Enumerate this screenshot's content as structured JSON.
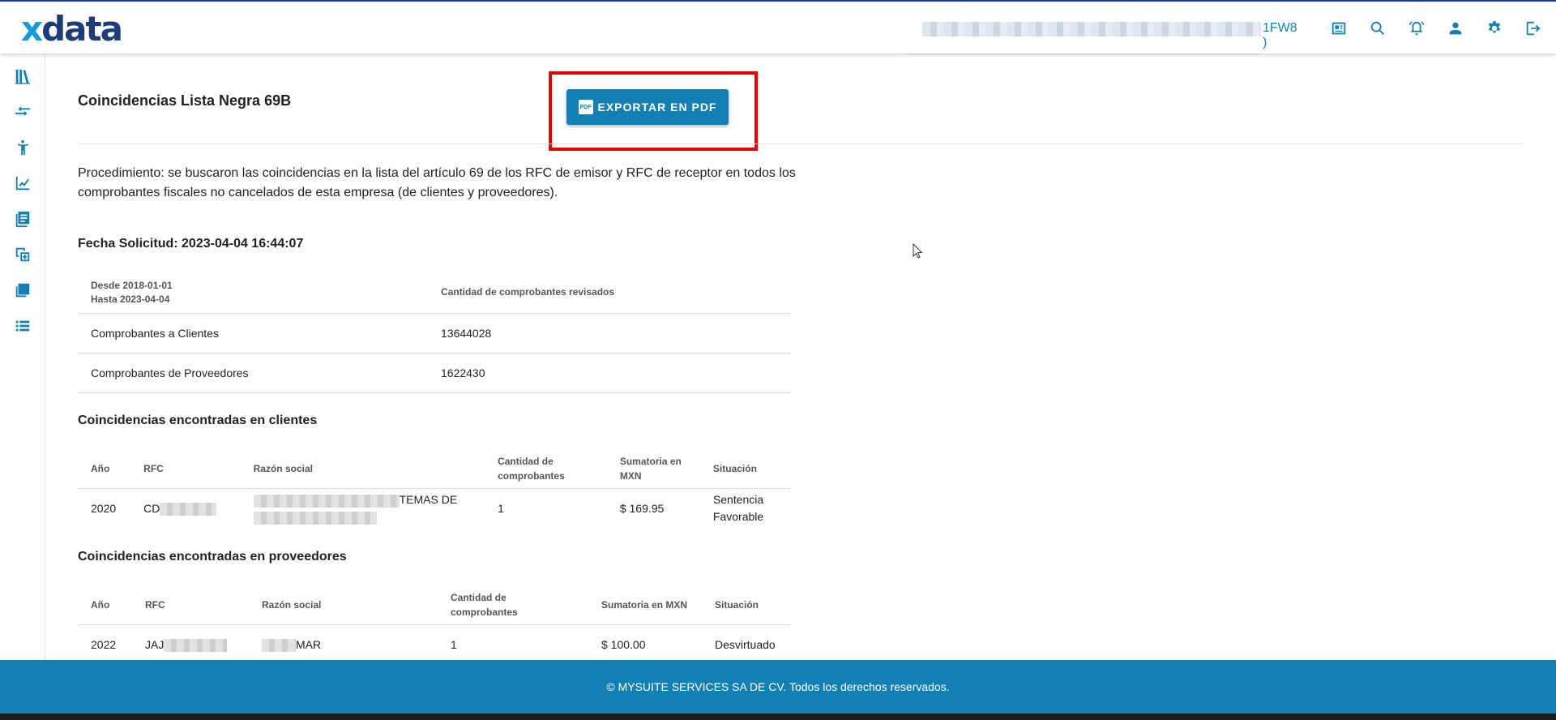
{
  "header": {
    "logo_x": "x",
    "logo_rest": "data",
    "company_suffix": "1FW8 )",
    "icons": [
      "news-icon",
      "search-icon",
      "alarm-icon",
      "user-icon",
      "settings-icon",
      "logout-icon"
    ]
  },
  "sidebar": {
    "icons": [
      "library-icon",
      "compare-arrows-icon",
      "person-icon",
      "chart-line-icon",
      "document-list-icon",
      "copy-transform-icon",
      "layers-icon",
      "list-icon"
    ]
  },
  "main": {
    "title": "Coincidencias Lista Negra 69B",
    "export_label": "EXPORTAR EN PDF",
    "pdf_badge": "PDF",
    "procedure": "Procedimiento: se buscaron las coincidencias en la lista del artículo 69 de los RFC de emisor y RFC de receptor en todos los comprobantes fiscales no cancelados de esta empresa (de clientes y proveedores).",
    "fecha": "Fecha Solicitud: 2023-04-04 16:44:07",
    "summary": {
      "header_desde": "Desde 2018-01-01",
      "header_hasta": "Hasta 2023-04-04",
      "header_cantidad": "Cantidad de comprobantes revisados",
      "rows": [
        {
          "label": "Comprobantes a Clientes",
          "value": "13644028"
        },
        {
          "label": "Comprobantes de Proveedores",
          "value": "1622430"
        }
      ]
    },
    "clientes": {
      "title": "Coincidencias encontradas en clientes",
      "headers": [
        "Año",
        "RFC",
        "Razón social",
        "Cantidad de comprobantes",
        "Sumatoria en MXN",
        "Situación"
      ],
      "rows": [
        {
          "anio": "2020",
          "rfc": "CD",
          "razon": "TEMAS DE",
          "cantidad": "1",
          "suma": "$ 169.95",
          "situacion": "Sentencia Favorable"
        }
      ]
    },
    "proveedores": {
      "title": "Coincidencias encontradas en proveedores",
      "headers": [
        "Año",
        "RFC",
        "Razón social",
        "Cantidad de comprobantes",
        "Sumatoria en MXN",
        "Situación"
      ],
      "rows": [
        {
          "anio": "2022",
          "rfc": "JAJ",
          "razon": "MAR",
          "cantidad": "1",
          "suma": "$ 100.00",
          "situacion": "Desvirtuado"
        }
      ]
    }
  },
  "footer": {
    "text": "© MYSUITE SERVICES SA DE CV. Todos los derechos reservados."
  },
  "colors": {
    "primary": "#1380b4",
    "logo_dark": "#1d3c78",
    "logo_light": "#1a9bd7",
    "highlight": "#e00000"
  }
}
